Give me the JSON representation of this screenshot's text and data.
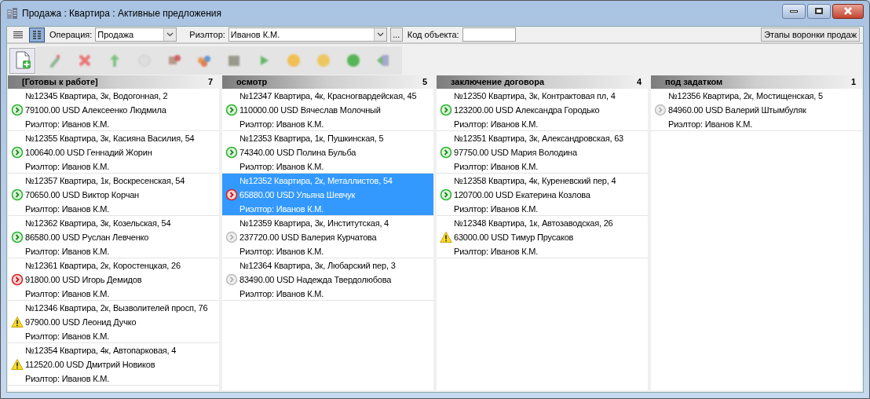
{
  "window": {
    "title": "Продажа : Квартира : Активные предложения"
  },
  "view_buttons": [
    {
      "kind": "list",
      "selected": false
    },
    {
      "kind": "columns",
      "selected": true
    }
  ],
  "filters": {
    "operation_label": "Операция:",
    "operation_value": "Продажа",
    "realtor_label": "Риэлтор:",
    "realtor_value": "Иванов К.М.",
    "more_button": "...",
    "code_label": "Код объекта:",
    "stages_button": "Этапы воронки продаж"
  },
  "columns": [
    {
      "title": "[Готовы к работе]",
      "count": "7",
      "cards": [
        {
          "line1": "№12345 Квартира, 3к, Водогонная, 2",
          "line2": "79100.00 USD Алексеенко Людмила",
          "line3": "Риэлтор: Иванов К.М.",
          "kind": "ok",
          "selected": false
        },
        {
          "line1": "№12355 Квартира, 3к, Касияна Василия, 54",
          "line2": "100640.00 USD Геннадий Жорин",
          "line3": "Риэлтор: Иванов К.М.",
          "kind": "ok",
          "selected": false
        },
        {
          "line1": "№12357 Квартира, 1к, Воскресенская, 54",
          "line2": "70650.00 USD Виктор Корчан",
          "line3": "Риэлтор: Иванов К.М.",
          "kind": "ok",
          "selected": false
        },
        {
          "line1": "№12362 Квартира, 3к, Козельская, 54",
          "line2": "86580.00 USD Руслан Левченко",
          "line3": "Риэлтор: Иванов К.М.",
          "kind": "ok",
          "selected": false
        },
        {
          "line1": "№12361 Квартира, 2к, Коростенцкая, 26",
          "line2": "91800.00 USD Игорь Демидов",
          "line3": "Риэлтор: Иванов К.М.",
          "kind": "overdue",
          "selected": false
        },
        {
          "line1": "№12346 Квартира, 2к, Вызволителей просп, 76",
          "line2": "97900.00 USD Леонид Дучко",
          "line3": "Риэлтор: Иванов К.М.",
          "kind": "warning",
          "selected": false
        },
        {
          "line1": "№12354 Квартира, 4к, Автопарковая, 4",
          "line2": "112520.00 USD Дмитрий Новиков",
          "line3": "Риэлтор: Иванов К.М.",
          "kind": "warning",
          "selected": false
        }
      ]
    },
    {
      "title": "осмотр",
      "count": "5",
      "cards": [
        {
          "line1": "№12347 Квартира, 4к, Красногвардейская, 45",
          "line2": "110000.00 USD Вячеслав Молочный",
          "line3": "Риэлтор: Иванов К.М.",
          "kind": "ok",
          "selected": false
        },
        {
          "line1": "№12353 Квартира, 1к, Пушкинская, 5",
          "line2": "74340.00 USD Полина Бульба",
          "line3": "Риэлтор: Иванов К.М.",
          "kind": "ok",
          "selected": false
        },
        {
          "line1": "№12352 Квартира, 2к, Металлистов, 54",
          "line2": "65880.00 USD Ульяна Шевчук",
          "line3": "Риэлтор: Иванов К.М.",
          "kind": "overdue",
          "selected": true
        },
        {
          "line1": "№12359 Квартира, 3к, Институтская, 4",
          "line2": "237720.00 USD Валерия Курчатова",
          "line3": "Риэлтор: Иванов К.М.",
          "kind": "idle",
          "selected": false
        },
        {
          "line1": "№12364 Квартира, 3к, Любарский пер, 3",
          "line2": "83490.00 USD Надежда Твердолюбова",
          "line3": "Риэлтор: Иванов К.М.",
          "kind": "idle",
          "selected": false
        }
      ]
    },
    {
      "title": "заключение договора",
      "count": "4",
      "cards": [
        {
          "line1": "№12350 Квартира, 3к, Контрактовая пл, 4",
          "line2": "123200.00 USD Александра Городько",
          "line3": "Риэлтор: Иванов К.М.",
          "kind": "ok",
          "selected": false
        },
        {
          "line1": "№12351 Квартира, 3к, Александровская, 63",
          "line2": "97750.00 USD Мария Володина",
          "line3": "Риэлтор: Иванов К.М.",
          "kind": "ok",
          "selected": false
        },
        {
          "line1": "№12358 Квартира, 4к, Куреневский пер, 4",
          "line2": "120700.00 USD Екатерина Козлова",
          "line3": "Риэлтор: Иванов К.М.",
          "kind": "ok",
          "selected": false
        },
        {
          "line1": "№12348 Квартира, 1к, Автозаводская, 26",
          "line2": "63000.00 USD Тимур Прусаков",
          "line3": "Риэлтор: Иванов К.М.",
          "kind": "warning",
          "selected": false
        }
      ]
    },
    {
      "title": "под задатком",
      "count": "1",
      "cards": [
        {
          "line1": "№12356 Квартира, 2к, Мостищенская, 5",
          "line2": "84960.00 USD Валерий Штымбуляк",
          "line3": "Риэлтор: Иванов К.М.",
          "kind": "idle",
          "selected": false
        }
      ]
    }
  ]
}
